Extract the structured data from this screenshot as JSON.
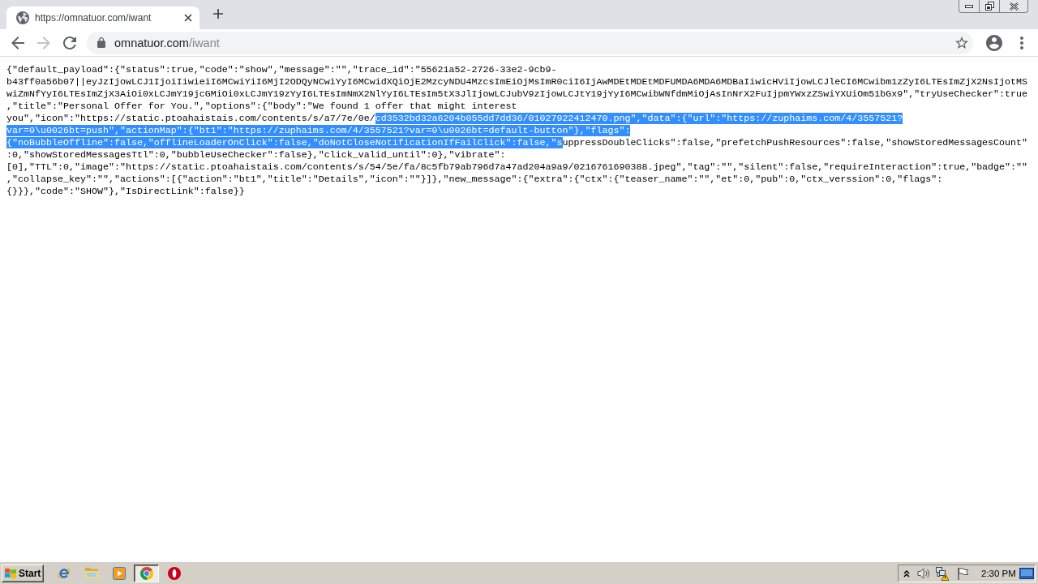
{
  "tabs": [
    {
      "title": "https://omnatuor.com/iwant",
      "selected": true
    }
  ],
  "toolbar": {
    "back": {
      "disabled": false
    },
    "forward": {
      "disabled": true
    },
    "address_bar": {
      "host": "omnatuor.com",
      "path": "/iwant"
    }
  },
  "page_text": {
    "lines": [
      {
        "segments": [
          {
            "text": "{\"default_payload\":{\"status\":true,\"code\":\"show\",\"message\":\"\",\"trace_id\":\"55621a52-2726-33e2-9cb9-",
            "selected": false
          }
        ]
      },
      {
        "segments": [
          {
            "text": "b43ff0a56b07||eyJzIjowLCJ1IjoiIiwieiI6MCwiYiI6MjI2ODQyNCwiYyI6MCwidXQiOjE2MzcyNDU4MzcsImEiOjMsImR0ciI6IjAwMDEtMDEtMDFUMDA6MDA6MDBaIiwicHViIjowLCJleCI6MCwibm1zZyI6LTEsImZjX2NsIjotMS",
            "selected": false
          }
        ]
      },
      {
        "segments": [
          {
            "text": "wiZmNfYyI6LTEsImZjX3AiOi0xLCJmY19jcGMiOi0xLCJmY19zYyI6LTEsImNmX2NlYyI6LTEsIm5tX3JlIjowLCJubV9zIjowLCJtY19jYyI6MCwibWNfdmMiOjAsInNrX2FuIjpmYWxzZSwiYXUiOm51bGx9\",\"tryUseChecker\":true",
            "selected": false
          }
        ]
      },
      {
        "segments": [
          {
            "text": ",\"title\":\"Personal Offer for You.\",\"options\":{\"body\":\"We found 1 offer that might interest",
            "selected": false
          }
        ]
      },
      {
        "segments": [
          {
            "text": "you\",\"icon\":\"https://static.ptoahaistais.com/contents/s/a7/7e/0e/",
            "selected": false
          },
          {
            "text": "cd3532bd32a6204b055dd7dd36/01027922412470.png\",\"data\":{\"url\":\"https://zuphaims.com/4/3557521?",
            "selected": true
          }
        ]
      },
      {
        "segments": [
          {
            "text": "var=0\\u0026bt=push\",\"actionMap\":{\"bt1\":\"https://zuphaims.com/4/3557521?var=0\\u0026bt=default-button\"},\"flags\":",
            "selected": true
          }
        ]
      },
      {
        "segments": [
          {
            "text": "{\"noBubbleOffline\":false,\"offlineLoaderOnClick\":false,\"doNotCloseNotificationIfFailClick\":false,\"s",
            "selected": true
          },
          {
            "text": "uppressDoubleClicks\":false,\"prefetchPushResources\":false,\"showStoredMessagesCount\"",
            "selected": false
          }
        ]
      },
      {
        "segments": [
          {
            "text": ":0,\"showStoredMessagesTtl\":0,\"bubbleUseChecker\":false},\"click_valid_until\":0},\"vibrate\":",
            "selected": false
          }
        ]
      },
      {
        "segments": [
          {
            "text": "[0],\"TTL\":0,\"image\":\"https://static.ptoahaistais.com/contents/s/54/5e/fa/8c5fb79ab796d7a47ad204a9a9/0216761690388.jpeg\",\"tag\":\"\",\"silent\":false,\"requireInteraction\":true,\"badge\":\"\"",
            "selected": false
          }
        ]
      },
      {
        "segments": [
          {
            "text": ",\"collapse_key\":\"\",\"actions\":[{\"action\":\"bt1\",\"title\":\"Details\",\"icon\":\"\"}]},\"new_message\":{\"extra\":{\"ctx\":{\"teaser_name\":\"\",\"et\":0,\"pub\":0,\"ctx_verssion\":0,\"flags\":",
            "selected": false
          }
        ]
      },
      {
        "segments": [
          {
            "text": "{}}},\"code\":\"SHOW\"},\"IsDirectLink\":false}}",
            "selected": false
          }
        ]
      }
    ]
  },
  "taskbar": {
    "start_label": "Start",
    "apps": [
      {
        "kind": "letter-e",
        "selected": false
      },
      {
        "kind": "folder",
        "selected": false
      },
      {
        "kind": "play",
        "selected": false
      },
      {
        "kind": "tri-color",
        "selected": true
      },
      {
        "kind": "letter-o",
        "selected": false
      }
    ],
    "clock": "2:30 PM"
  }
}
